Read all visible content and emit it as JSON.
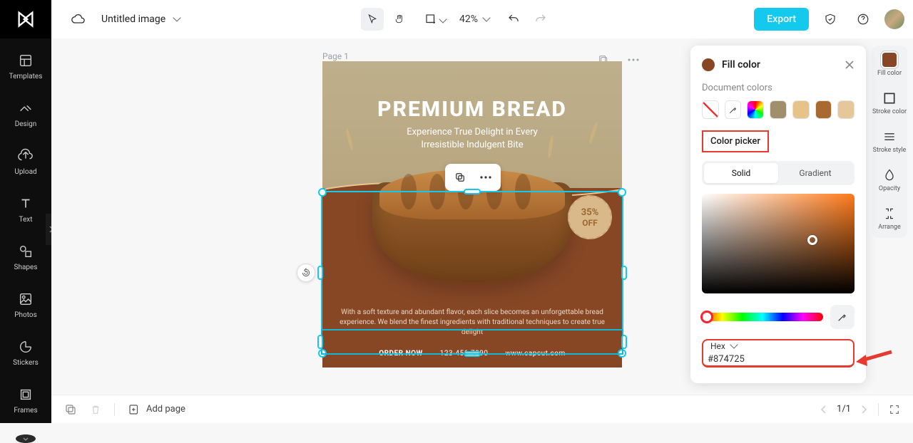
{
  "header": {
    "doc_title": "Untitled image",
    "zoom": "42%",
    "export": "Export"
  },
  "leftbar": {
    "templates": "Templates",
    "design": "Design",
    "upload": "Upload",
    "text": "Text",
    "shapes": "Shapes",
    "photos": "Photos",
    "stickers": "Stickers",
    "frames": "Frames"
  },
  "canvas": {
    "page_label": "Page 1",
    "headline": "PREMIUM BREAD",
    "subhead_l1": "Experience True Delight in Every",
    "subhead_l2": "Irresistible Indulgent Bite",
    "badge_pct": "35%",
    "badge_off": "OFF",
    "body": "With a soft texture and abundant flavor, each slice becomes an unforgettable bread experience. We blend the finest ingredients with traditional techniques to create true delight",
    "order": "ORDER NOW",
    "phone": "123-456-7890",
    "site": "www.capcut.com"
  },
  "rightrail": {
    "fill": "Fill color",
    "stroke_color": "Stroke color",
    "stroke_style": "Stroke style",
    "opacity": "Opacity",
    "arrange": "Arrange"
  },
  "panel": {
    "title": "Fill color",
    "doc_colors_label": "Document colors",
    "picker_label": "Color picker",
    "tab_solid": "Solid",
    "tab_gradient": "Gradient",
    "hex_label": "Hex",
    "hex_value": "#874725",
    "doc_swatches": [
      "#a08f6a",
      "#e8c389",
      "#a96a32",
      "#e6c79a"
    ]
  },
  "bottombar": {
    "add_page": "Add page",
    "page_indicator": "1/1"
  }
}
